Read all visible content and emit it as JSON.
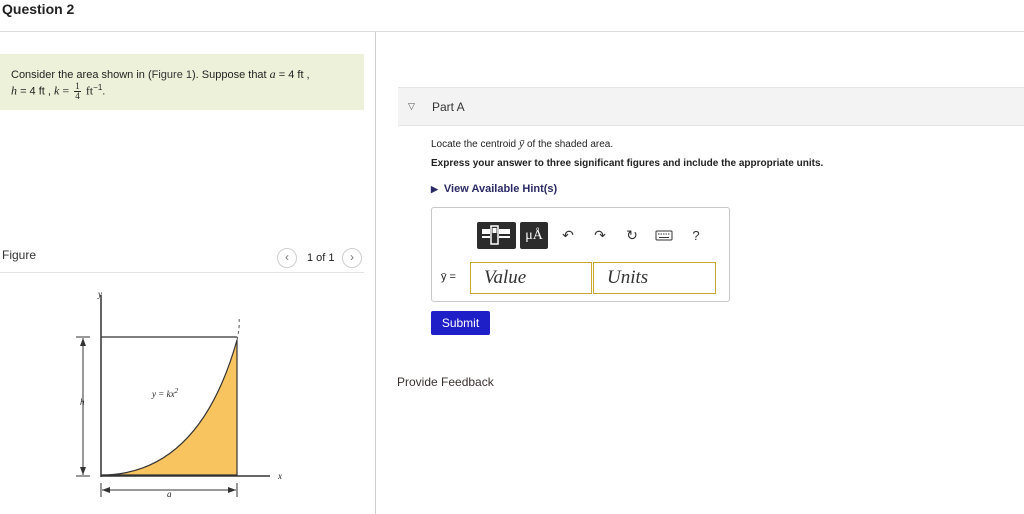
{
  "question": {
    "title": "Question 2"
  },
  "problem": {
    "lead": "Consider the area shown in (",
    "figure_link": "Figure 1",
    "middle": "). Suppose that ",
    "a_var": "a",
    "a_value": "= 4 ft ,",
    "h_var": "h",
    "h_value": "= 4 ft ,",
    "k_var": "k",
    "k_eq": "=",
    "k_num": "1",
    "k_den": "4",
    "k_unit": "ft",
    "k_exp": "−1",
    "end": "."
  },
  "figure": {
    "label": "Figure",
    "prev_icon": "chevron-left",
    "next_icon": "chevron-right",
    "page": "1 of 1",
    "axis_y": "y",
    "axis_x": "x",
    "dim_h": "h",
    "dim_a": "a",
    "curve_label": "y = kx",
    "curve_exp": "2",
    "fill_color": "#f8c45f"
  },
  "part_a": {
    "caret_icon": "triangle-down",
    "title": "Part A",
    "locate_pre": "Locate the centroid ",
    "locate_var": "ȳ",
    "locate_post": " of the shaded area.",
    "express": "Express your answer to three significant figures and include the appropriate units.",
    "hint_icon": "triangle-right",
    "hint": "View Available Hint(s)"
  },
  "answer": {
    "toolbar": {
      "templates_icon": "templates-icon",
      "units_label": "μÅ",
      "undo_icon": "undo-arrow",
      "redo_icon": "redo-arrow",
      "reset_icon": "reset-circle",
      "keyboard_icon": "keyboard",
      "help_label": "?"
    },
    "ybar_label": "ȳ =",
    "value_placeholder": "Value",
    "units_placeholder": "Units"
  },
  "submit_label": "Submit",
  "feedback_label": "Provide Feedback"
}
